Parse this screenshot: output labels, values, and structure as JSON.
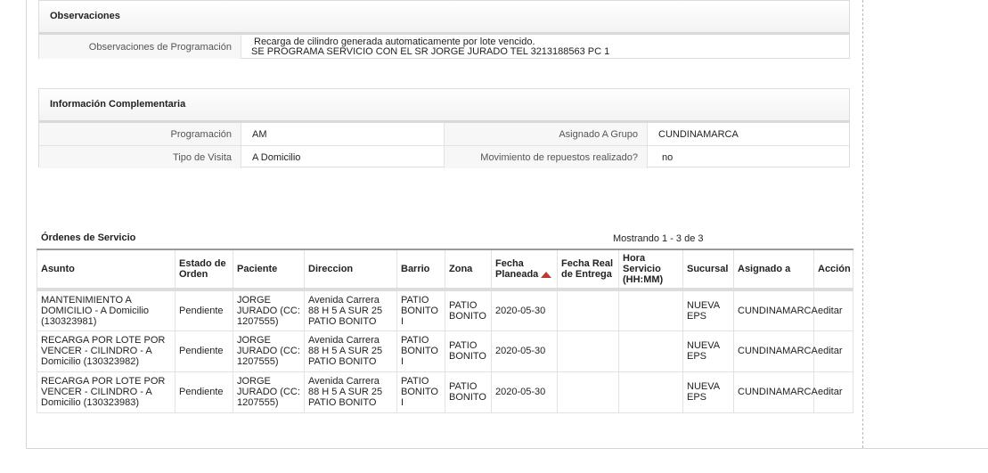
{
  "observaciones": {
    "title": "Observaciones",
    "label": "Observaciones de Programación",
    "value_line1": "Recarga de cilindro generada automaticamente por lote vencido.",
    "value_line2": "SE PROGRAMA SERVICIO CON EL SR JORGE JURADO TEL 3213188563 PC 1"
  },
  "info": {
    "title": "Información Complementaria",
    "programacion_label": "Programación",
    "programacion_value": "AM",
    "grupo_label": "Asignado A Grupo",
    "grupo_value": "CUNDINAMARCA",
    "visita_label": "Tipo de Visita",
    "visita_value": "A Domicilio",
    "repuestos_label": "Movimiento de repuestos realizado?",
    "repuestos_value": "no"
  },
  "orders": {
    "title": "Órdenes de Servicio",
    "count": "Mostrando 1 - 3 de 3",
    "headers": {
      "asunto": "Asunto",
      "estado": "Estado de Orden",
      "paciente": "Paciente",
      "direccion": "Direccion",
      "barrio": "Barrio",
      "zona": "Zona",
      "fecha_planeada": "Fecha Planeada",
      "fecha_real": "Fecha Real de Entrega",
      "hora": "Hora Servicio (HH:MM)",
      "sucursal": "Sucursal",
      "asignado": "Asignado a",
      "accion": "Acción"
    },
    "rows": [
      {
        "asunto": "MANTENIMIENTO A DOMICILIO - A Domicilio (130323981)",
        "estado": "Pendiente",
        "paciente": "JORGE JURADO (CC: 1207555)",
        "direccion": "Avenida Carrera 88 H 5 A SUR 25 PATIO BONITO",
        "barrio": "PATIO BONITO I",
        "zona": "PATIO BONITO",
        "fecha_planeada": "2020-05-30",
        "fecha_real": "",
        "hora": "",
        "sucursal": "NUEVA EPS",
        "asignado": "CUNDINAMARCA",
        "accion": "editar"
      },
      {
        "asunto": "RECARGA POR LOTE POR VENCER - CILINDRO - A Domicilio (130323982)",
        "estado": "Pendiente",
        "paciente": "JORGE JURADO (CC: 1207555)",
        "direccion": "Avenida Carrera 88 H 5 A SUR 25 PATIO BONITO",
        "barrio": "PATIO BONITO I",
        "zona": "PATIO BONITO",
        "fecha_planeada": "2020-05-30",
        "fecha_real": "",
        "hora": "",
        "sucursal": "NUEVA EPS",
        "asignado": "CUNDINAMARCA",
        "accion": "editar"
      },
      {
        "asunto": "RECARGA POR LOTE POR VENCER - CILINDRO - A Domicilio (130323983)",
        "estado": "Pendiente",
        "paciente": "JORGE JURADO (CC: 1207555)",
        "direccion": "Avenida Carrera 88 H 5 A SUR 25 PATIO BONITO",
        "barrio": "PATIO BONITO I",
        "zona": "PATIO BONITO",
        "fecha_planeada": "2020-05-30",
        "fecha_real": "",
        "hora": "",
        "sucursal": "NUEVA EPS",
        "asignado": "CUNDINAMARCA",
        "accion": "editar"
      }
    ]
  }
}
